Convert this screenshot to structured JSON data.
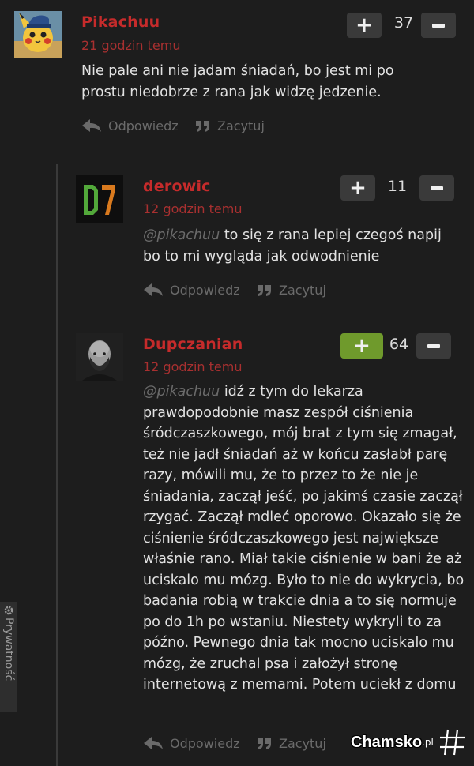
{
  "comments": [
    {
      "author": "Pikachuu",
      "time": "21 godzin temu",
      "mention": "",
      "text": "Nie pale ani nie jadam śniadań, bo jest mi po prostu niedobrze z rana jak widzę jedzenie.",
      "score": "37",
      "upvoted": false,
      "reply_label": "Odpowiedz",
      "quote_label": "Zacytuj"
    },
    {
      "author": "derowic",
      "time": "12 godzin temu",
      "mention": "@pikachuu",
      "text": "to się z rana lepiej czegoś napij bo to mi wygląda jak odwodnienie",
      "score": "11",
      "upvoted": false,
      "reply_label": "Odpowiedz",
      "quote_label": "Zacytuj"
    },
    {
      "author": "Dupczanian",
      "time": "12 godzin temu",
      "mention": "@pikachuu",
      "text": "idź z tym do lekarza prawdopodobnie masz zespół ciśnienia śródczaszkowego, mój brat z tym się zmagał, też nie jadł śniadań aż w końcu zasłabł parę razy, mówili mu, że to przez to że nie je śniadania, zaczął jeść, po jakimś czasie zaczął rzygać. Zaczął mdleć oporowo. Okazało się że ciśnienie śródczaszkowego jest największe właśnie rano. Miał takie ciśnienie w bani że aż uciskalo mu mózg. Było to nie do wykrycia, bo badania robią w trakcie dnia a to się normuje po do 1h po wstaniu. Niestety wykryli to za późno. Pewnego dnia tak mocno uciskalo mu mózg, że zruchal psa i założył stronę internetową z memami. Potem uciekł z domu",
      "score": "64",
      "upvoted": true,
      "reply_label": "Odpowiedz",
      "quote_label": "Zacytuj"
    }
  ],
  "privacy_label": "Prywatność",
  "watermark": {
    "text": "Chamsko",
    "suffix": ".pl"
  },
  "colors": {
    "background": "#1d1d1d",
    "author": "#c62b2b",
    "upvote_active": "#6f9a2c",
    "button": "#3a3a3a"
  },
  "icons": [
    "reply-arrow-icon",
    "quote-icon",
    "plus-icon",
    "minus-icon",
    "gear-icon",
    "hashtag-logo-icon"
  ]
}
